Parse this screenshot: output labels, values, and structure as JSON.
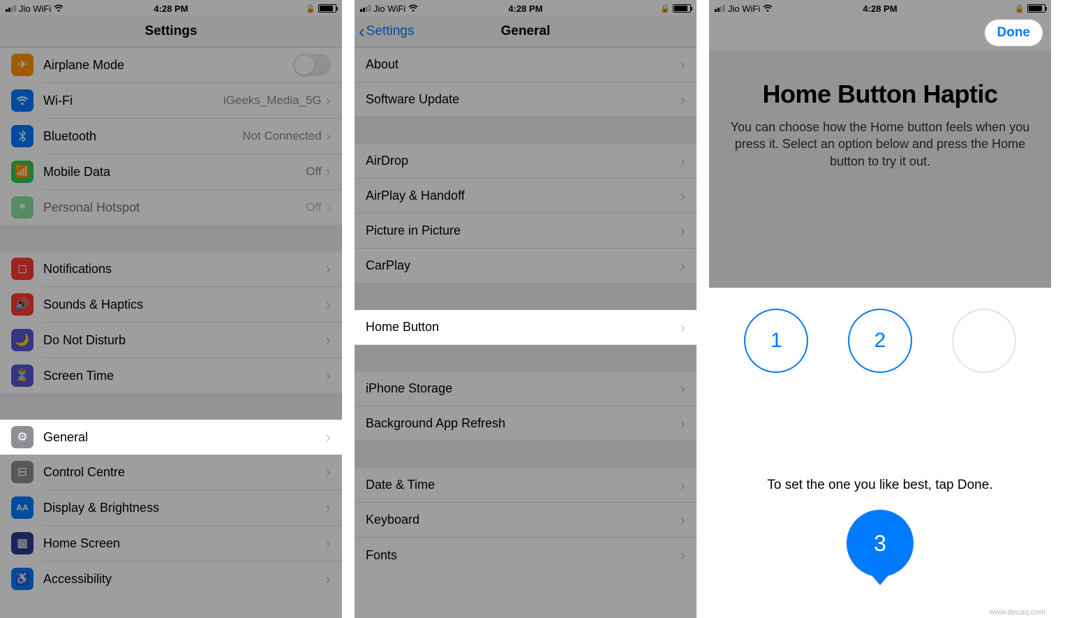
{
  "status": {
    "carrier": "Jio WiFi",
    "time": "4:28 PM"
  },
  "screen1": {
    "title": "Settings",
    "items": {
      "airplane": "Airplane Mode",
      "wifi": "Wi-Fi",
      "wifi_val": "iGeeks_Media_5G",
      "bluetooth": "Bluetooth",
      "bluetooth_val": "Not Connected",
      "mobile": "Mobile Data",
      "mobile_val": "Off",
      "hotspot": "Personal Hotspot",
      "hotspot_val": "Off",
      "notifications": "Notifications",
      "sounds": "Sounds & Haptics",
      "dnd": "Do Not Disturb",
      "screentime": "Screen Time",
      "general": "General",
      "control": "Control Centre",
      "display": "Display & Brightness",
      "home": "Home Screen",
      "accessibility": "Accessibility"
    }
  },
  "screen2": {
    "back": "Settings",
    "title": "General",
    "items": {
      "about": "About",
      "software": "Software Update",
      "airdrop": "AirDrop",
      "airplay": "AirPlay & Handoff",
      "pip": "Picture in Picture",
      "carplay": "CarPlay",
      "homebutton": "Home Button",
      "storage": "iPhone Storage",
      "bg": "Background App Refresh",
      "datetime": "Date & Time",
      "keyboard": "Keyboard",
      "fonts": "Fonts"
    }
  },
  "screen3": {
    "done": "Done",
    "title": "Home Button Haptic",
    "desc": "You can choose how the Home button feels when you press it. Select an option below and press the Home button to try it out.",
    "opt1": "1",
    "opt2": "2",
    "opt3": "3",
    "hint": "To set the one you like best, tap Done."
  },
  "watermark": "www.deuaq.com"
}
